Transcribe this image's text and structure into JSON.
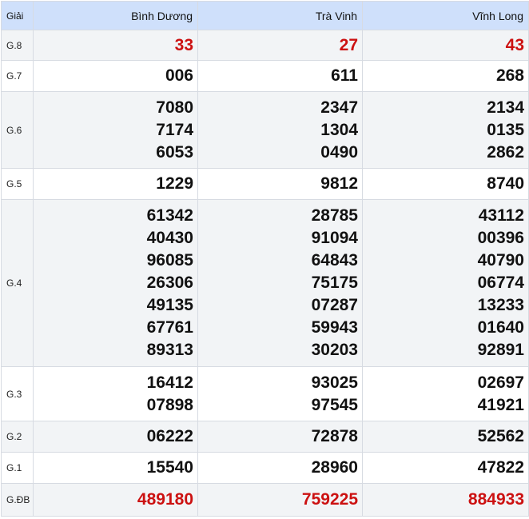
{
  "header": {
    "label": "Giải",
    "provinces": [
      "Bình Dương",
      "Trà Vinh",
      "Vĩnh Long"
    ]
  },
  "colors": {
    "header_bg": "#cfe0fb",
    "highlight": "#cc1111",
    "alt_row_bg": "#f2f4f6"
  },
  "prizes": [
    {
      "label": "G.8",
      "results": [
        [
          "33"
        ],
        [
          "27"
        ],
        [
          "43"
        ]
      ]
    },
    {
      "label": "G.7",
      "results": [
        [
          "006"
        ],
        [
          "611"
        ],
        [
          "268"
        ]
      ]
    },
    {
      "label": "G.6",
      "results": [
        [
          "7080",
          "7174",
          "6053"
        ],
        [
          "2347",
          "1304",
          "0490"
        ],
        [
          "2134",
          "0135",
          "2862"
        ]
      ]
    },
    {
      "label": "G.5",
      "results": [
        [
          "1229"
        ],
        [
          "9812"
        ],
        [
          "8740"
        ]
      ]
    },
    {
      "label": "G.4",
      "results": [
        [
          "61342",
          "40430",
          "96085",
          "26306",
          "49135",
          "67761",
          "89313"
        ],
        [
          "28785",
          "91094",
          "64843",
          "75175",
          "07287",
          "59943",
          "30203"
        ],
        [
          "43112",
          "00396",
          "40790",
          "06774",
          "13233",
          "01640",
          "92891"
        ]
      ]
    },
    {
      "label": "G.3",
      "results": [
        [
          "16412",
          "07898"
        ],
        [
          "93025",
          "97545"
        ],
        [
          "02697",
          "41921"
        ]
      ]
    },
    {
      "label": "G.2",
      "results": [
        [
          "06222"
        ],
        [
          "72878"
        ],
        [
          "52562"
        ]
      ]
    },
    {
      "label": "G.1",
      "results": [
        [
          "15540"
        ],
        [
          "28960"
        ],
        [
          "47822"
        ]
      ]
    },
    {
      "label": "G.ĐB",
      "results": [
        [
          "489180"
        ],
        [
          "759225"
        ],
        [
          "884933"
        ]
      ]
    }
  ]
}
